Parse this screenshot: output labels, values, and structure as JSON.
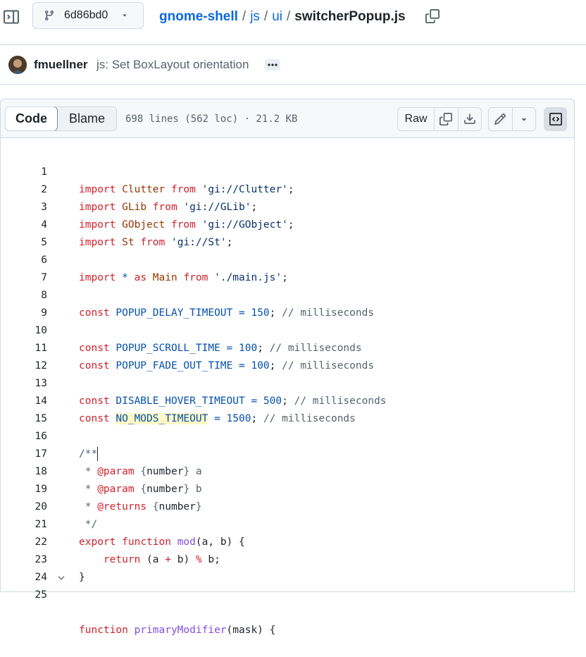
{
  "header": {
    "branch": "6d86bd0",
    "breadcrumb": {
      "repo": "gnome-shell",
      "sep": "/",
      "dir1": "js",
      "dir2": "ui",
      "file": "switcherPopup.js"
    }
  },
  "commit": {
    "author": "fmuellner",
    "message": "js: Set BoxLayout orientation"
  },
  "file_header": {
    "tabs": [
      "Code",
      "Blame"
    ],
    "active_tab": "Code",
    "meta": "698 lines (562 loc) · 21.2 KB",
    "raw_label": "Raw"
  },
  "code": {
    "lines": [
      {
        "n": "1"
      },
      {
        "n": "2"
      },
      {
        "n": "3"
      },
      {
        "n": "4"
      },
      {
        "n": "5"
      },
      {
        "n": "6"
      },
      {
        "n": "7"
      },
      {
        "n": "8"
      },
      {
        "n": "9"
      },
      {
        "n": "10"
      },
      {
        "n": "11"
      },
      {
        "n": "12"
      },
      {
        "n": "13"
      },
      {
        "n": "14"
      },
      {
        "n": "15"
      },
      {
        "n": "16"
      },
      {
        "n": "17"
      },
      {
        "n": "18"
      },
      {
        "n": "19"
      },
      {
        "n": "20"
      },
      {
        "n": "21"
      },
      {
        "n": "22"
      },
      {
        "n": "23"
      },
      {
        "n": "24"
      },
      {
        "n": "25"
      }
    ],
    "tokens": {
      "import": "import",
      "from": "from",
      "as": "as",
      "star": "*",
      "const": "const",
      "export": "export",
      "function": "function",
      "return": "return",
      "Clutter": "Clutter",
      "GLib": "GLib",
      "GObject": "GObject",
      "St": "St",
      "Main": "Main",
      "s_clutter": "'gi://Clutter'",
      "s_glib": "'gi://GLib'",
      "s_gobject": "'gi://GObject'",
      "s_st": "'gi://St'",
      "s_main": "'./main.js'",
      "semi": ";",
      "eq": "=",
      "c_ms": "// milliseconds",
      "POPUP_DELAY_TIMEOUT": "POPUP_DELAY_TIMEOUT",
      "v150": "150",
      "POPUP_SCROLL_TIME": "POPUP_SCROLL_TIME",
      "v100": "100",
      "POPUP_FADE_OUT_TIME": "POPUP_FADE_OUT_TIME",
      "DISABLE_HOVER_TIMEOUT": "DISABLE_HOVER_TIMEOUT",
      "v500": "500",
      "NO_MODS_TIMEOUT": "NO_MODS_TIMEOUT",
      "v1500": "1500",
      "doc_open": "/**",
      "doc_star": " * ",
      "doc_close": " */",
      "param": "@param",
      "returns": "@returns",
      "lb": "{",
      "rb": "}",
      "number": "number",
      "a": "a",
      "b": "b",
      "mod": "mod",
      "mod_args": "(a, b) {",
      "ret_open": "(a ",
      "plus": "+",
      "ret_mid": " b) ",
      "pct": "%",
      "ret_end": " b;",
      "close_brace": "}",
      "primaryModifier": "primaryModifier",
      "pm_args": "(mask) {"
    }
  },
  "colors": {
    "link": "#0969da",
    "keyword": "#cf222e",
    "entity": "#953800",
    "string": "#0a3069",
    "constant": "#0550ae",
    "comment": "#59636e",
    "function": "#8250df",
    "highlight": "#fff8c5"
  },
  "icons": {
    "sidebar": "sidebar-expand-icon",
    "branch": "git-branch-icon",
    "caret": "triangle-down-icon",
    "copy": "copy-icon",
    "kebab": "kebab-horizontal-icon",
    "download": "download-icon",
    "edit": "pencil-icon",
    "symbols": "code-square-icon",
    "fold": "chevron-down-icon"
  }
}
